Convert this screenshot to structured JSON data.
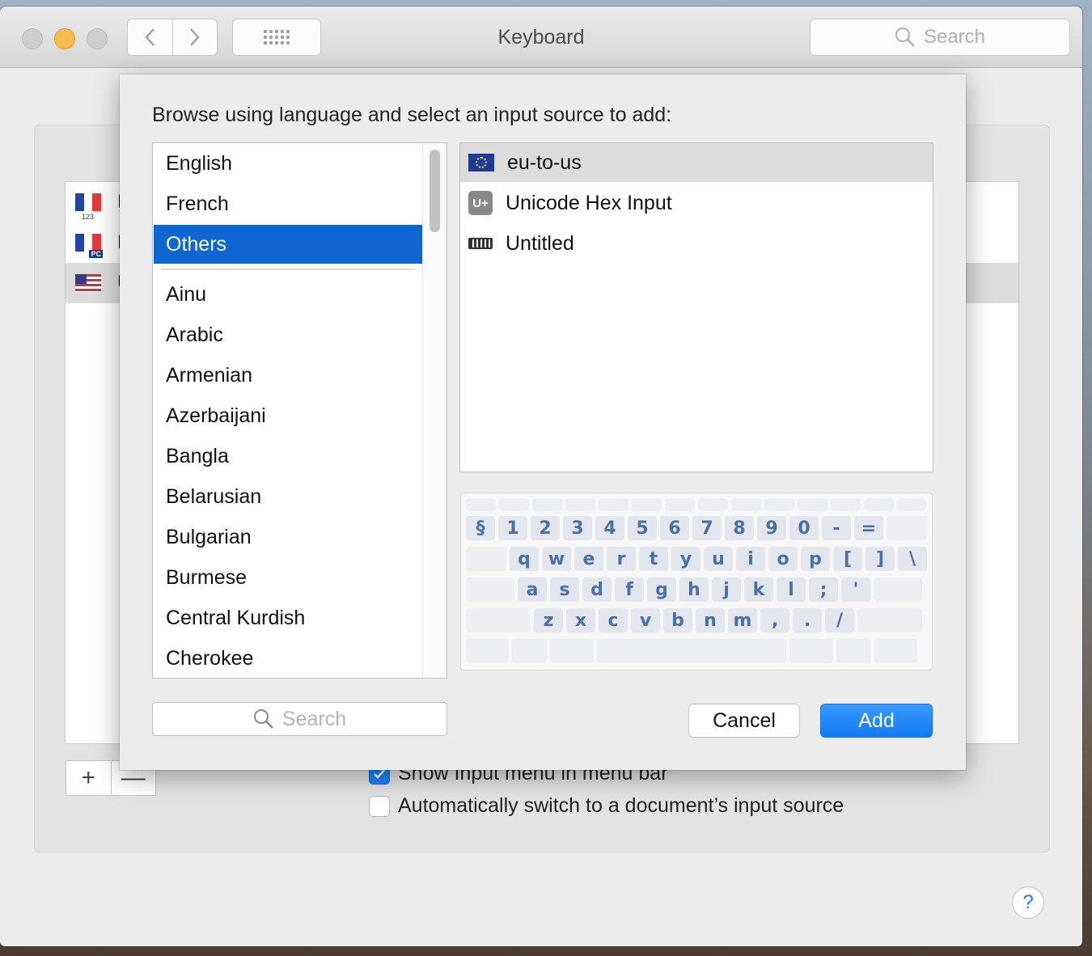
{
  "window": {
    "title": "Keyboard",
    "search_placeholder": "Search"
  },
  "colors": {
    "accent": "#1179f2",
    "selection": "#0f66d0",
    "key_text": "#4c6fa6"
  },
  "icons": {
    "back": "chevron-left-icon",
    "forward": "chevron-right-icon",
    "grid": "grid-icon",
    "search": "search-icon",
    "help": "help-icon"
  },
  "input_sources": [
    {
      "name": "F",
      "flag": "fr-123"
    },
    {
      "name": "F",
      "flag": "fr-pc"
    },
    {
      "name": "U",
      "flag": "us",
      "selected": true
    }
  ],
  "list_controls": {
    "add": "+",
    "remove": "—"
  },
  "options": {
    "show_input_menu": {
      "label": "Show Input menu in menu bar",
      "checked": true
    },
    "auto_switch": {
      "label": "Automatically switch to a document’s input source",
      "checked": false
    }
  },
  "help_label": "?",
  "sheet": {
    "prompt": "Browse using language and select an input source to add:",
    "top_languages": [
      "English",
      "French",
      "Others"
    ],
    "selected_language": "Others",
    "languages": [
      "Ainu",
      "Arabic",
      "Armenian",
      "Azerbaijani",
      "Bangla",
      "Belarusian",
      "Bulgarian",
      "Burmese",
      "Central Kurdish",
      "Cherokee"
    ],
    "sources": [
      {
        "name": "eu-to-us",
        "icon": "eu-flag-icon",
        "highlighted": true
      },
      {
        "name": "Unicode Hex Input",
        "icon": "unicode-hex-icon"
      },
      {
        "name": "Untitled",
        "icon": "keyboard-icon"
      }
    ],
    "uplus_label": "U+",
    "keyboard_rows": [
      [
        "§",
        "1",
        "2",
        "3",
        "4",
        "5",
        "6",
        "7",
        "8",
        "9",
        "0",
        "-",
        "="
      ],
      [
        "q",
        "w",
        "e",
        "r",
        "t",
        "y",
        "u",
        "i",
        "o",
        "p",
        "[",
        "]",
        "\\"
      ],
      [
        "a",
        "s",
        "d",
        "f",
        "g",
        "h",
        "j",
        "k",
        "l",
        ";",
        "'"
      ],
      [
        "z",
        "x",
        "c",
        "v",
        "b",
        "n",
        "m",
        ",",
        ".",
        "/"
      ]
    ],
    "search_placeholder": "Search",
    "cancel_label": "Cancel",
    "add_label": "Add"
  }
}
